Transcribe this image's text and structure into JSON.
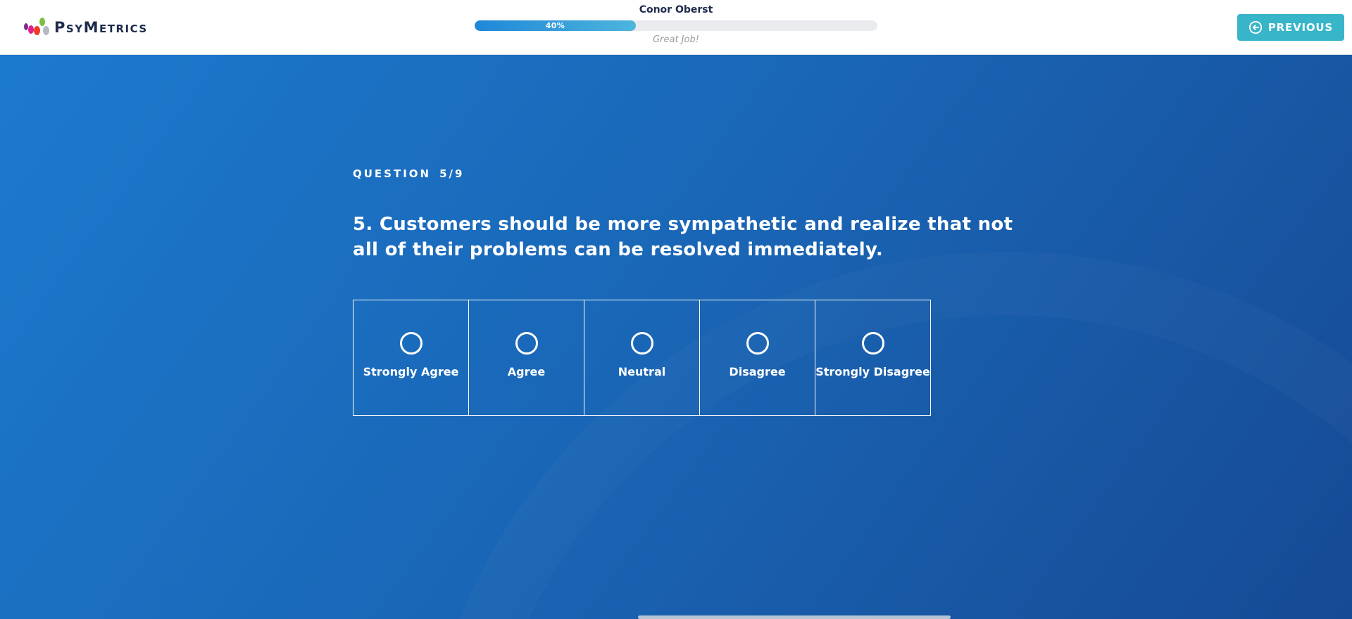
{
  "header": {
    "logo": {
      "segments": [
        "P",
        "SY",
        "M",
        "ETRICS"
      ],
      "full_name": "PsyMetrics"
    },
    "user_name": "Conor Oberst",
    "progress": {
      "percent": 40,
      "label": "40%",
      "message": "Great Job!"
    },
    "previous_label": "PREVIOUS"
  },
  "question": {
    "counter_label": "QUESTION",
    "counter_value": "5/9",
    "text": "5. Customers should be more sympathetic and realize that not all of their problems can be resolved immediately."
  },
  "options": [
    {
      "label": "Strongly Agree"
    },
    {
      "label": "Agree"
    },
    {
      "label": "Neutral"
    },
    {
      "label": "Disagree"
    },
    {
      "label": "Strongly Disagree"
    }
  ],
  "icons": {
    "previous": "arrow-left-circle",
    "option": "radio-circle",
    "brand": "colored-dots"
  },
  "colors": {
    "brand-navy": "#1d2b4d",
    "accent-teal": "#38b5c8",
    "bg-top": "#1c7ace",
    "bg-mid": "#1a66b6",
    "bg-bottom": "#164a94",
    "track-gray": "#e9ebee",
    "fill-from": "#1f87d7",
    "fill-to": "#4eb5dd",
    "muted-gray": "#9b9b9b",
    "dot-purple": "#7b2d8e",
    "dot-magenta": "#e0218a",
    "dot-red": "#ee3b24",
    "dot-green": "#7ac143",
    "dot-gray": "#b4bac4",
    "scroll-thumb": "#c7d0da"
  }
}
